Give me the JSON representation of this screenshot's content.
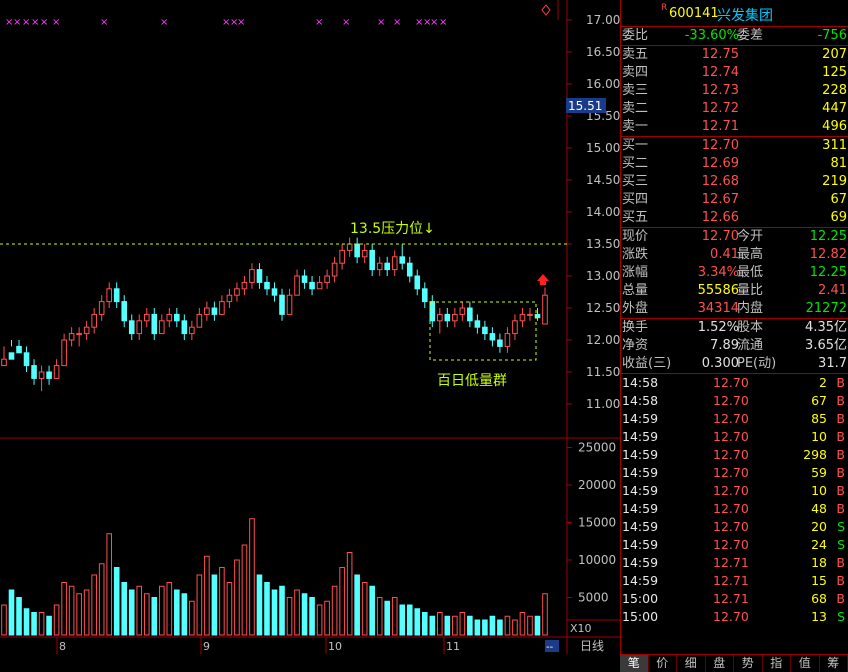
{
  "stock": {
    "badge": "R",
    "code": "600141",
    "name": "兴发集团"
  },
  "ratio": {
    "label1": "委比",
    "value1": "-33.60%",
    "label2": "委差",
    "value2": "-756"
  },
  "asks": [
    {
      "label": "卖五",
      "price": "12.75",
      "vol": "207"
    },
    {
      "label": "卖四",
      "price": "12.74",
      "vol": "125"
    },
    {
      "label": "卖三",
      "price": "12.73",
      "vol": "228"
    },
    {
      "label": "卖二",
      "price": "12.72",
      "vol": "447"
    },
    {
      "label": "卖一",
      "price": "12.71",
      "vol": "496"
    }
  ],
  "bids": [
    {
      "label": "买一",
      "price": "12.70",
      "vol": "311"
    },
    {
      "label": "买二",
      "price": "12.69",
      "vol": "81"
    },
    {
      "label": "买三",
      "price": "12.68",
      "vol": "219"
    },
    {
      "label": "买四",
      "price": "12.67",
      "vol": "67"
    },
    {
      "label": "买五",
      "price": "12.66",
      "vol": "69"
    }
  ],
  "quote": [
    {
      "l1": "现价",
      "v1": "12.70",
      "c1": "red",
      "l2": "今开",
      "v2": "12.25",
      "c2": "green"
    },
    {
      "l1": "涨跌",
      "v1": "0.41",
      "c1": "red",
      "l2": "最高",
      "v2": "12.82",
      "c2": "red"
    },
    {
      "l1": "涨幅",
      "v1": "3.34%",
      "c1": "red",
      "l2": "最低",
      "v2": "12.25",
      "c2": "green"
    },
    {
      "l1": "总量",
      "v1": "55586",
      "c1": "yel",
      "l2": "量比",
      "v2": "2.41",
      "c2": "red"
    },
    {
      "l1": "外盘",
      "v1": "34314",
      "c1": "red",
      "l2": "内盘",
      "v2": "21272",
      "c2": "green"
    }
  ],
  "stats": [
    {
      "l1": "换手",
      "v1": "1.52%",
      "l2": "股本",
      "v2": "4.35亿"
    },
    {
      "l1": "净资",
      "v1": "7.89",
      "l2": "流通",
      "v2": "3.65亿"
    },
    {
      "l1": "收益(三)",
      "v1": "0.300",
      "l2": "PE(动)",
      "v2": "31.7"
    }
  ],
  "ticks": [
    {
      "time": "14:58",
      "price": "12.70",
      "vol": "2",
      "side": "B"
    },
    {
      "time": "14:58",
      "price": "12.70",
      "vol": "67",
      "side": "B"
    },
    {
      "time": "14:59",
      "price": "12.70",
      "vol": "85",
      "side": "B"
    },
    {
      "time": "14:59",
      "price": "12.70",
      "vol": "10",
      "side": "B"
    },
    {
      "time": "14:59",
      "price": "12.70",
      "vol": "298",
      "side": "B"
    },
    {
      "time": "14:59",
      "price": "12.70",
      "vol": "59",
      "side": "B"
    },
    {
      "time": "14:59",
      "price": "12.70",
      "vol": "10",
      "side": "B"
    },
    {
      "time": "14:59",
      "price": "12.70",
      "vol": "48",
      "side": "B"
    },
    {
      "time": "14:59",
      "price": "12.70",
      "vol": "20",
      "side": "S"
    },
    {
      "time": "14:59",
      "price": "12.70",
      "vol": "24",
      "side": "S"
    },
    {
      "time": "14:59",
      "price": "12.71",
      "vol": "18",
      "side": "B"
    },
    {
      "time": "14:59",
      "price": "12.71",
      "vol": "15",
      "side": "B"
    },
    {
      "time": "15:00",
      "price": "12.71",
      "vol": "68",
      "side": "B"
    },
    {
      "time": "15:00",
      "price": "12.70",
      "vol": "13",
      "side": "S"
    }
  ],
  "tabs": [
    "笔",
    "价",
    "细",
    "盘",
    "势",
    "指",
    "值",
    "筹"
  ],
  "chart": {
    "price_ticks": [
      "17.00",
      "16.50",
      "16.00",
      "15.50",
      "15.00",
      "14.50",
      "14.00",
      "13.50",
      "13.00",
      "12.50",
      "12.00",
      "11.50",
      "11.00"
    ],
    "price_label": "15.51",
    "resistance_label": "13.5压力位↓",
    "box_label": "百日低量群",
    "vol_ticks": [
      "25000",
      "20000",
      "15000",
      "10000",
      "5000"
    ],
    "vol_unit": "X10",
    "months": [
      "8",
      "9",
      "10",
      "11"
    ],
    "period": "日线",
    "scroll": "--"
  },
  "chart_data": {
    "type": "candlestick",
    "ylim": [
      10.75,
      17.1
    ],
    "resistance": 13.5,
    "candles": [
      [
        11.6,
        11.9,
        11.6,
        11.7
      ],
      [
        11.8,
        12.0,
        11.9,
        11.7
      ],
      [
        11.9,
        12.0,
        11.8,
        11.8
      ],
      [
        11.8,
        11.9,
        11.5,
        11.6
      ],
      [
        11.6,
        11.7,
        11.3,
        11.4
      ],
      [
        11.4,
        11.6,
        11.2,
        11.5
      ],
      [
        11.5,
        11.6,
        11.3,
        11.4
      ],
      [
        11.4,
        11.7,
        11.4,
        11.6
      ],
      [
        11.6,
        12.1,
        11.6,
        12.0
      ],
      [
        12.0,
        12.2,
        11.9,
        12.1
      ],
      [
        12.1,
        12.2,
        11.9,
        12.1
      ],
      [
        12.1,
        12.3,
        12.0,
        12.2
      ],
      [
        12.2,
        12.5,
        12.1,
        12.4
      ],
      [
        12.4,
        12.7,
        12.3,
        12.6
      ],
      [
        12.6,
        12.9,
        12.5,
        12.8
      ],
      [
        12.8,
        12.9,
        12.5,
        12.6
      ],
      [
        12.6,
        12.7,
        12.2,
        12.3
      ],
      [
        12.3,
        12.4,
        12.0,
        12.1
      ],
      [
        12.1,
        12.4,
        12.0,
        12.3
      ],
      [
        12.3,
        12.5,
        12.2,
        12.4
      ],
      [
        12.4,
        12.5,
        12.0,
        12.1
      ],
      [
        12.1,
        12.4,
        12.1,
        12.3
      ],
      [
        12.3,
        12.5,
        12.2,
        12.4
      ],
      [
        12.4,
        12.5,
        12.2,
        12.3
      ],
      [
        12.3,
        12.4,
        12.0,
        12.1
      ],
      [
        12.1,
        12.3,
        12.0,
        12.2
      ],
      [
        12.2,
        12.5,
        12.2,
        12.4
      ],
      [
        12.4,
        12.6,
        12.3,
        12.5
      ],
      [
        12.5,
        12.6,
        12.3,
        12.4
      ],
      [
        12.4,
        12.7,
        12.4,
        12.6
      ],
      [
        12.6,
        12.8,
        12.5,
        12.7
      ],
      [
        12.7,
        12.9,
        12.6,
        12.8
      ],
      [
        12.8,
        13.0,
        12.7,
        12.9
      ],
      [
        12.9,
        13.2,
        12.8,
        13.1
      ],
      [
        13.1,
        13.2,
        12.8,
        12.9
      ],
      [
        12.9,
        13.0,
        12.7,
        12.8
      ],
      [
        12.8,
        12.9,
        12.6,
        12.7
      ],
      [
        12.7,
        12.8,
        12.3,
        12.4
      ],
      [
        12.4,
        12.8,
        12.4,
        12.7
      ],
      [
        12.7,
        13.1,
        12.7,
        13.0
      ],
      [
        13.0,
        13.1,
        12.8,
        12.9
      ],
      [
        12.9,
        13.0,
        12.7,
        12.8
      ],
      [
        12.8,
        13.0,
        12.8,
        12.9
      ],
      [
        12.9,
        13.1,
        12.8,
        13.0
      ],
      [
        13.0,
        13.3,
        12.9,
        13.2
      ],
      [
        13.2,
        13.5,
        13.1,
        13.4
      ],
      [
        13.4,
        13.6,
        13.3,
        13.5
      ],
      [
        13.5,
        13.6,
        13.2,
        13.3
      ],
      [
        13.3,
        13.5,
        13.2,
        13.4
      ],
      [
        13.4,
        13.5,
        13.0,
        13.1
      ],
      [
        13.1,
        13.3,
        13.0,
        13.2
      ],
      [
        13.2,
        13.3,
        13.0,
        13.1
      ],
      [
        13.1,
        13.4,
        13.0,
        13.3
      ],
      [
        13.3,
        13.5,
        13.1,
        13.2
      ],
      [
        13.2,
        13.3,
        12.9,
        13.0
      ],
      [
        13.0,
        13.1,
        12.7,
        12.8
      ],
      [
        12.8,
        12.9,
        12.5,
        12.6
      ],
      [
        12.6,
        12.7,
        12.2,
        12.3
      ],
      [
        12.3,
        12.5,
        12.1,
        12.4
      ],
      [
        12.4,
        12.5,
        12.2,
        12.3
      ],
      [
        12.3,
        12.5,
        12.2,
        12.4
      ],
      [
        12.4,
        12.6,
        12.3,
        12.5
      ],
      [
        12.5,
        12.6,
        12.2,
        12.3
      ],
      [
        12.3,
        12.4,
        12.1,
        12.2
      ],
      [
        12.2,
        12.3,
        12.0,
        12.1
      ],
      [
        12.1,
        12.2,
        11.9,
        12.0
      ],
      [
        12.0,
        12.1,
        11.8,
        11.9
      ],
      [
        11.9,
        12.2,
        11.8,
        12.1
      ],
      [
        12.1,
        12.4,
        12.0,
        12.3
      ],
      [
        12.3,
        12.5,
        12.2,
        12.4
      ],
      [
        12.4,
        12.5,
        12.3,
        12.4
      ],
      [
        12.4,
        12.5,
        12.3,
        12.35
      ],
      [
        12.25,
        12.82,
        12.25,
        12.7
      ]
    ],
    "volumes": [
      4000,
      6000,
      5000,
      3500,
      3000,
      3000,
      2500,
      4000,
      7000,
      6500,
      5500,
      6000,
      8000,
      9500,
      13500,
      9000,
      7000,
      6000,
      6500,
      5500,
      5000,
      6500,
      7000,
      6000,
      5500,
      4500,
      8000,
      10500,
      8000,
      9000,
      7000,
      10000,
      12000,
      15500,
      8000,
      7000,
      6000,
      6500,
      5000,
      6000,
      5500,
      5000,
      4000,
      4500,
      6500,
      9000,
      11000,
      8000,
      7000,
      6500,
      5000,
      4500,
      5000,
      4000,
      4000,
      3500,
      3000,
      2500,
      3000,
      2500,
      2500,
      3000,
      2500,
      2000,
      2000,
      2500,
      2000,
      2500,
      2000,
      3000,
      2500,
      2500,
      5500
    ],
    "vol_ylim": [
      0,
      26000
    ]
  }
}
